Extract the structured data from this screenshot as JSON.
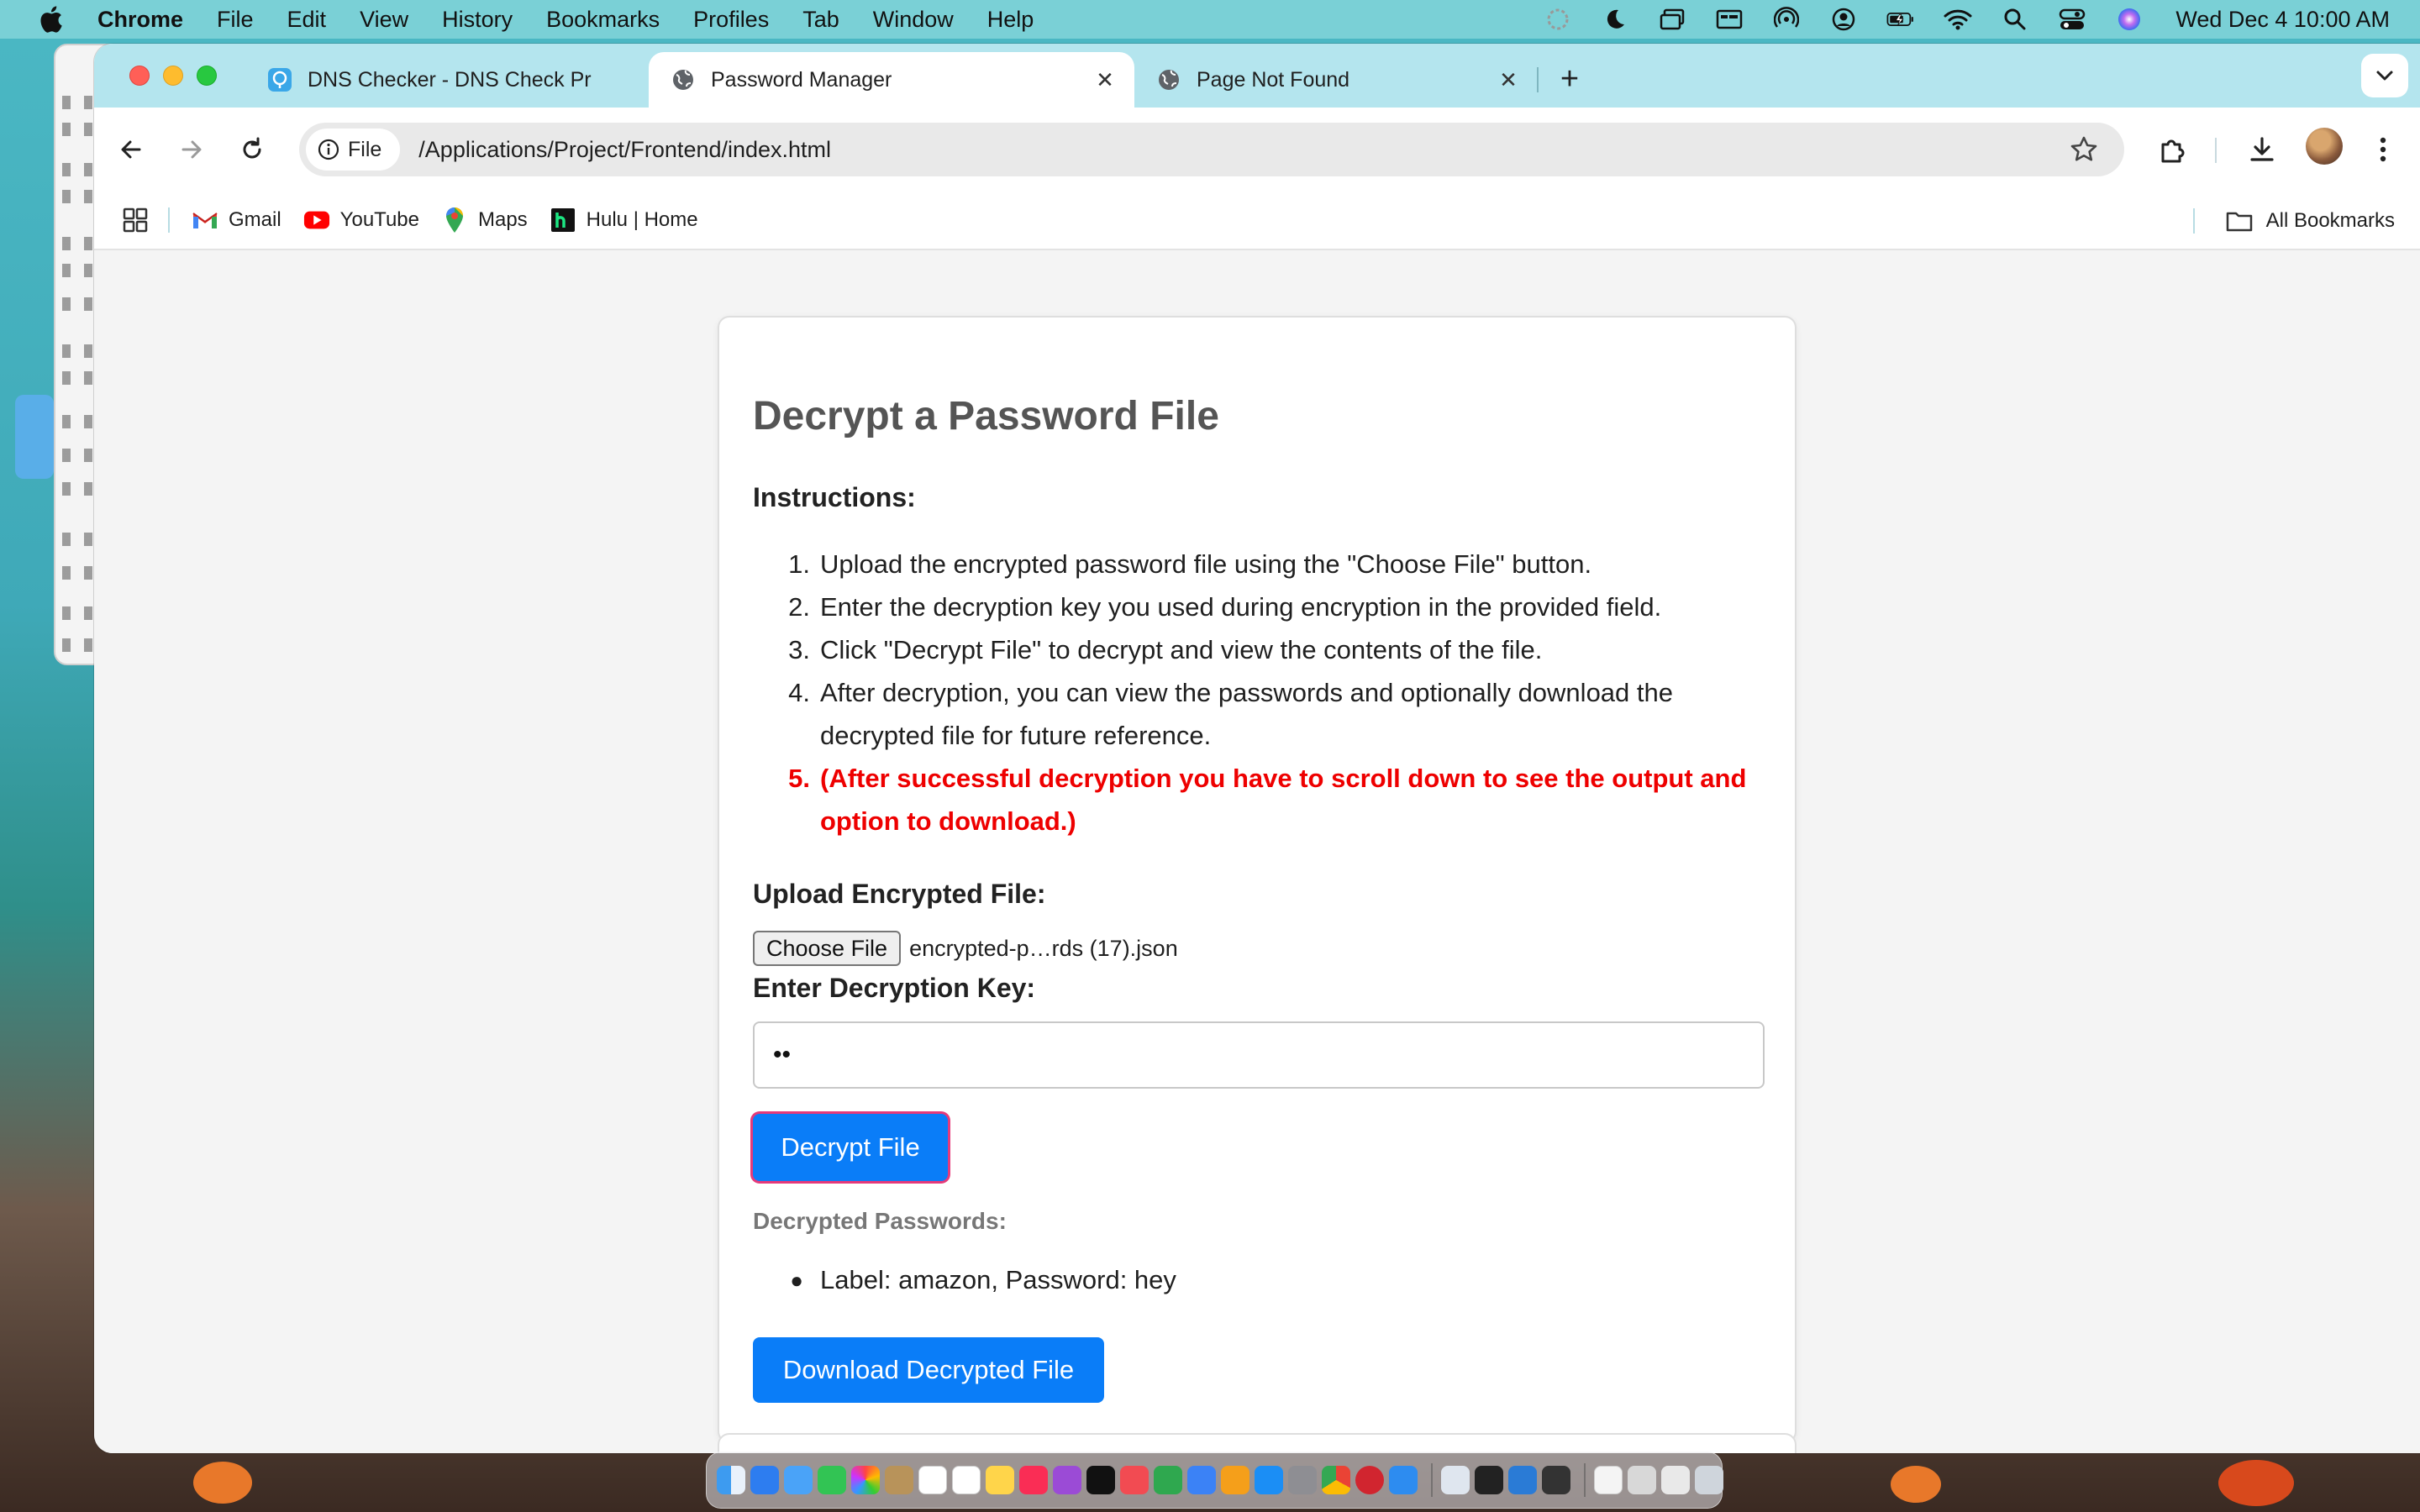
{
  "menubar": {
    "app_name": "Chrome",
    "items": [
      "File",
      "Edit",
      "View",
      "History",
      "Bookmarks",
      "Profiles",
      "Tab",
      "Window",
      "Help"
    ],
    "clock": "Wed Dec 4  10:00 AM"
  },
  "tabs": [
    {
      "title": "DNS Checker - DNS Check Pr",
      "icon": "dns-checker-icon",
      "active": false
    },
    {
      "title": "Password Manager",
      "icon": "globe-icon",
      "active": true
    },
    {
      "title": "Page Not Found",
      "icon": "globe-icon",
      "active": false
    }
  ],
  "toolbar": {
    "chip_label": "File",
    "url": "/Applications/Project/Frontend/index.html"
  },
  "bookmarks": {
    "items": [
      {
        "label": "Gmail",
        "icon": "gmail-icon"
      },
      {
        "label": "YouTube",
        "icon": "youtube-icon"
      },
      {
        "label": "Maps",
        "icon": "maps-icon"
      },
      {
        "label": "Hulu | Home",
        "icon": "hulu-icon"
      }
    ],
    "all_label": "All Bookmarks"
  },
  "page": {
    "title": "Decrypt a Password File",
    "instructions_heading": "Instructions:",
    "steps": [
      {
        "num": "1.",
        "text": "Upload the encrypted password file using the \"Choose File\" button."
      },
      {
        "num": "2.",
        "text": "Enter the decryption key you used during encryption in the provided field."
      },
      {
        "num": "3.",
        "text": "Click \"Decrypt File\" to decrypt and view the contents of the file."
      },
      {
        "num": "4.",
        "text": "After decryption, you can view the passwords and optionally download the decrypted file for future reference."
      },
      {
        "num": "5.",
        "text": "(After successful decryption you have to scroll down to see the output and option to download.)"
      }
    ],
    "upload_label": "Upload Encrypted File:",
    "choose_file_label": "Choose File",
    "file_name": "encrypted-p…rds (17).json",
    "key_label": "Enter Decryption Key:",
    "key_value": "••",
    "decrypt_button": "Decrypt File",
    "output_heading": "Decrypted Passwords:",
    "output_items": [
      "Label: amazon, Password: hey"
    ],
    "download_button": "Download Decrypted File"
  },
  "colors": {
    "accent": "#0a7df8",
    "warning": "#ee0000",
    "title_gray": "#555555",
    "tabstrip": "#b4e5ee"
  }
}
